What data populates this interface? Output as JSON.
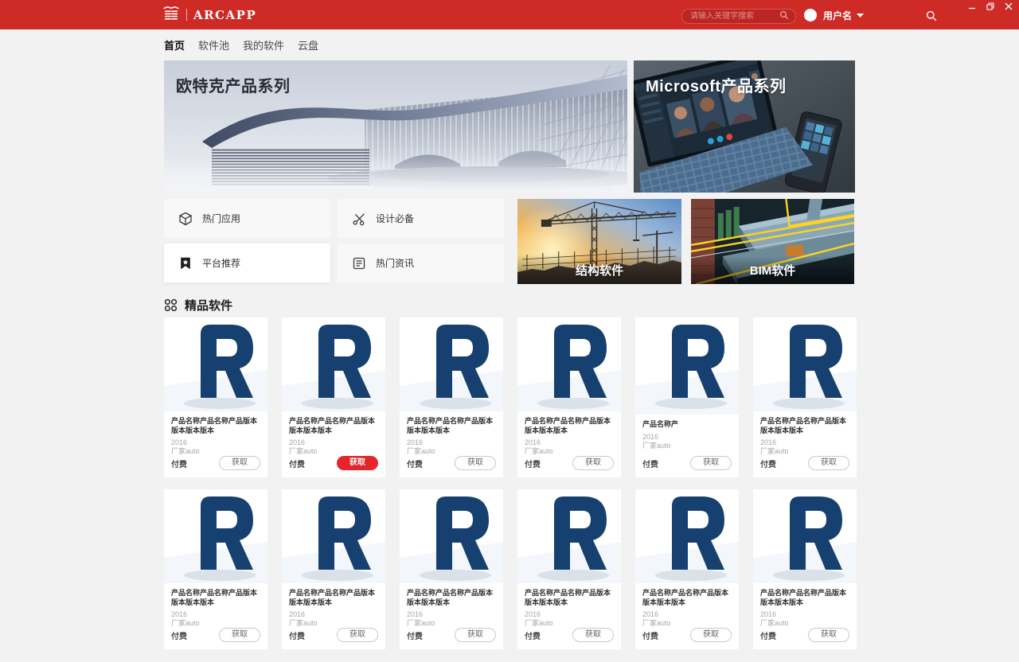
{
  "titlebar": {
    "app_name": "ARCAPP",
    "logo_icon": "dougong-bracket-icon",
    "search_placeholder": "请输入关键字搜索",
    "username": "用户名",
    "accent_color": "#ce2b27"
  },
  "window_controls": [
    "minimize",
    "restore",
    "close"
  ],
  "nav": {
    "items": [
      {
        "label": "首页",
        "active": true
      },
      {
        "label": "软件池",
        "active": false
      },
      {
        "label": "我的软件",
        "active": false
      },
      {
        "label": "云盘",
        "active": false
      }
    ]
  },
  "banners": [
    {
      "title": "欧特克产品系列",
      "theme": "light-architecture-render"
    },
    {
      "title": "Microsoft产品系列",
      "theme": "dark-laptop-videocall"
    }
  ],
  "categories": [
    {
      "label": "热门应用",
      "icon": "cube-icon",
      "highlighted": false
    },
    {
      "label": "设计必备",
      "icon": "design-tools-icon",
      "highlighted": false
    },
    {
      "label": "平台推荐",
      "icon": "bookmark-star-icon",
      "highlighted": true
    },
    {
      "label": "热门资讯",
      "icon": "news-icon",
      "highlighted": false
    }
  ],
  "feature_cards": [
    {
      "label": "结构软件",
      "image": "construction-crane-sunset"
    },
    {
      "label": "BIM软件",
      "image": "bim-mep-render"
    }
  ],
  "section": {
    "title": "精品软件",
    "icon": "grid-circles-icon"
  },
  "products": [
    {
      "title": "产品名称产品名称产品版本版本版本版本",
      "year": "2016",
      "vendor": "厂家auto",
      "price": "付费",
      "action": "获取",
      "action_style": "outline"
    },
    {
      "title": "产品名称产品名称产品版本版本版本版本",
      "year": "2016",
      "vendor": "厂家auto",
      "price": "付费",
      "action": "获取",
      "action_style": "filled"
    },
    {
      "title": "产品名称产品名称产品版本版本版本版本",
      "year": "2016",
      "vendor": "厂家auto",
      "price": "付费",
      "action": "获取",
      "action_style": "outline"
    },
    {
      "title": "产品名称产品名称产品版本版本版本版本",
      "year": "2016",
      "vendor": "厂家auto",
      "price": "付费",
      "action": "获取",
      "action_style": "outline"
    },
    {
      "title": "产品名称产",
      "year": "2016",
      "vendor": "厂家auto",
      "price": "付费",
      "action": "获取",
      "action_style": "outline"
    },
    {
      "title": "产品名称产品名称产品版本版本版本版本",
      "year": "2016",
      "vendor": "厂家auto",
      "price": "付费",
      "action": "获取",
      "action_style": "outline"
    },
    {
      "title": "产品名称产品名称产品版本版本版本版本",
      "year": "2016",
      "vendor": "厂家auto",
      "price": "付费",
      "action": "获取",
      "action_style": "outline"
    },
    {
      "title": "产品名称产品名称产品版本版本版本版本",
      "year": "2016",
      "vendor": "厂家auto",
      "price": "付费",
      "action": "获取",
      "action_style": "outline"
    },
    {
      "title": "产品名称产品名称产品版本版本版本版本",
      "year": "2016",
      "vendor": "厂家auto",
      "price": "付费",
      "action": "获取",
      "action_style": "outline"
    },
    {
      "title": "产品名称产品名称产品版本版本版本版本",
      "year": "2016",
      "vendor": "厂家auto",
      "price": "付费",
      "action": "获取",
      "action_style": "outline"
    },
    {
      "title": "产品名称产品名称产品版本版本版本版本",
      "year": "2016",
      "vendor": "厂家auto",
      "price": "付费",
      "action": "获取",
      "action_style": "outline"
    },
    {
      "title": "产品名称产品名称产品版本版本版本版本",
      "year": "2016",
      "vendor": "厂家auto",
      "price": "付费",
      "action": "获取",
      "action_style": "outline"
    }
  ]
}
